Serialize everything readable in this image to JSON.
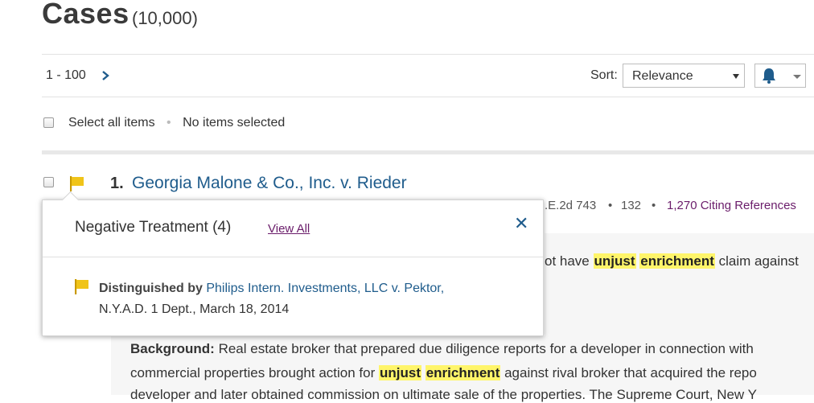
{
  "header": {
    "title": "Cases",
    "count": "(10,000)"
  },
  "pagination": {
    "range": "1 - 100"
  },
  "sort": {
    "label": "Sort:",
    "selected": "Relevance"
  },
  "selection": {
    "select_all": "Select all items",
    "status": "No items selected"
  },
  "result": {
    "number": "1.",
    "title": "Georgia Malone & Co., Inc. v. Rieder",
    "citation_fragment": ".E.2d 743",
    "pages": "132",
    "citing_refs": "1,270 Citing References",
    "snippet1_before": "ot have ",
    "snippet1_hl1": "unjust",
    "snippet1_hl2": "enrichment",
    "snippet1_after": " claim against",
    "background_label": "Background:",
    "background_line1": " Real estate broker that prepared due diligence reports for a developer in connection with",
    "background_line2_before": "commercial properties brought action for ",
    "background_hl1": "unjust",
    "background_hl2": "enrichment",
    "background_line2_after": " against rival broker that acquired the repo",
    "background_line3": "developer and later obtained commission on ultimate sale of the properties. The Supreme Court, New Y"
  },
  "popup": {
    "title": "Negative Treatment (4)",
    "view_all": "View All",
    "close": "✕",
    "treatment_label": "Distinguished by",
    "treatment_case": "Philips Intern. Investments, LLC v. Pektor,",
    "treatment_court": "N.Y.A.D. 1 Dept., March 18, 2014"
  },
  "colors": {
    "flag": "#f0c419",
    "link": "#1f5c8c",
    "highlight": "#fff56a",
    "bell": "#1f5c8c"
  },
  "icons": {
    "flag": "flag-icon",
    "bell": "bell-icon",
    "next": "chevron-right-icon",
    "close": "close-icon"
  }
}
